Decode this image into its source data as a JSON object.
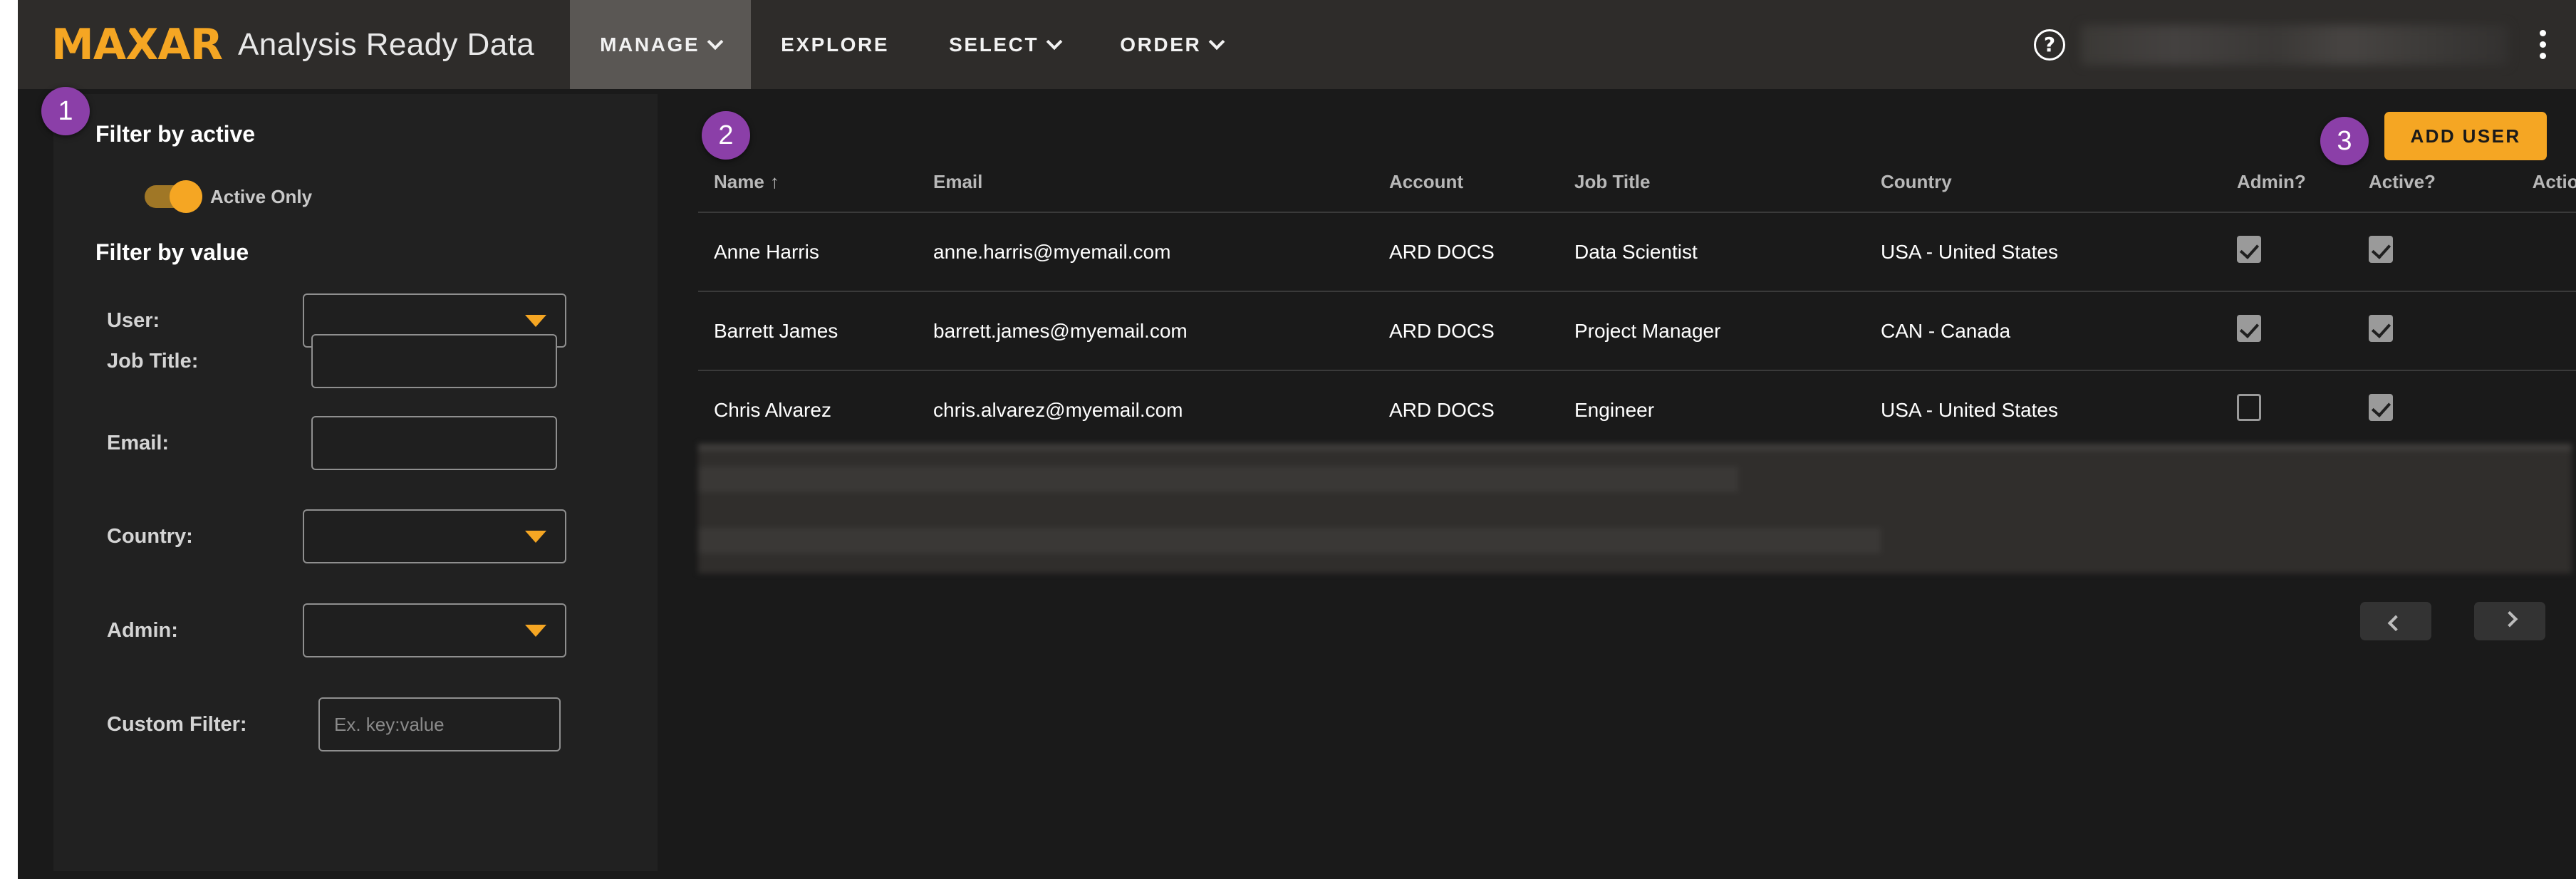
{
  "brand": {
    "logo": "MAXAR",
    "product": "Analysis Ready Data"
  },
  "nav": {
    "items": [
      {
        "label": "MANAGE",
        "has_chevron": true,
        "active": true
      },
      {
        "label": "EXPLORE",
        "has_chevron": false,
        "active": false
      },
      {
        "label": "SELECT",
        "has_chevron": true,
        "active": false
      },
      {
        "label": "ORDER",
        "has_chevron": true,
        "active": false
      }
    ],
    "help_icon": "help-question-icon",
    "overflow_icon": "kebab-menu-icon",
    "user_account": ""
  },
  "badges": {
    "one": "1",
    "two": "2",
    "three": "3",
    "color": "#8b3fa8"
  },
  "sidebar": {
    "filter_by_active_heading": "Filter by active",
    "active_only_label": "Active Only",
    "active_only_on": true,
    "filter_by_value_heading": "Filter by value",
    "fields": [
      {
        "label": "User:",
        "type": "select",
        "value": "",
        "placeholder": ""
      },
      {
        "label": "Job Title:",
        "type": "text",
        "value": "",
        "placeholder": ""
      },
      {
        "label": "Email:",
        "type": "text",
        "value": "",
        "placeholder": ""
      },
      {
        "label": "Country:",
        "type": "select",
        "value": "",
        "placeholder": ""
      },
      {
        "label": "Admin:",
        "type": "select",
        "value": "",
        "placeholder": ""
      },
      {
        "label": "Custom Filter:",
        "type": "text",
        "value": "",
        "placeholder": "Ex. key:value"
      }
    ]
  },
  "table": {
    "add_user_label": "ADD USER",
    "sort_column": "Name",
    "sort_direction": "↑",
    "headers": [
      "Name",
      "Email",
      "Account",
      "Job Title",
      "Country",
      "Admin?",
      "Active?",
      "Actions"
    ],
    "rows": [
      {
        "name": "Anne Harris",
        "email": "anne.harris@myemail.com",
        "account": "ARD DOCS",
        "job_title": "Data Scientist",
        "country": "USA - United States",
        "admin": true,
        "active": true
      },
      {
        "name": "Barrett James",
        "email": "barrett.james@myemail.com",
        "account": "ARD DOCS",
        "job_title": "Project Manager",
        "country": "CAN - Canada",
        "admin": true,
        "active": true
      },
      {
        "name": "Chris Alvarez",
        "email": "chris.alvarez@myemail.com",
        "account": "ARD DOCS",
        "job_title": "Engineer",
        "country": "USA - United States",
        "admin": false,
        "active": true
      }
    ]
  },
  "pagination": {
    "prev_icon": "chevron-left-icon",
    "next_icon": "chevron-right-icon"
  },
  "colors": {
    "accent_amber": "#f5a623",
    "badge_purple": "#8b3fa8",
    "topbar": "#2e2c2a",
    "sidebar": "#212121",
    "page_bg": "#1a1a1a"
  }
}
